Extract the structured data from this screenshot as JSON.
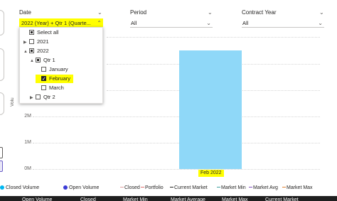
{
  "slicers": {
    "date": {
      "title": "Date",
      "value": "2022 (Year) + Qtr 1 (Quarte..."
    },
    "period": {
      "title": "Period",
      "value": "All"
    },
    "contract_year": {
      "title": "Contract Year",
      "value": "All"
    }
  },
  "date_tree": {
    "items": [
      {
        "label": "Select all",
        "state": "partial"
      },
      {
        "label": "2021",
        "state": "unchecked",
        "expandable": true,
        "expanded": false
      },
      {
        "label": "2022",
        "state": "partial",
        "expandable": true,
        "expanded": true
      },
      {
        "label": "Qtr 1",
        "state": "partial",
        "expandable": true,
        "expanded": true
      },
      {
        "label": "January",
        "state": "unchecked"
      },
      {
        "label": "February",
        "state": "checked",
        "highlighted": true
      },
      {
        "label": "March",
        "state": "unchecked"
      },
      {
        "label": "Qtr 2",
        "state": "unchecked",
        "expandable": true,
        "expanded": false
      }
    ]
  },
  "icons": {
    "expanded": "▲",
    "collapsed": "▶",
    "dropdown": "chevron-down-icon",
    "dropup": "chevron-up-icon"
  },
  "chart_data": {
    "type": "bar",
    "categories": [
      "Feb 2022"
    ],
    "values": [
      4.5
    ],
    "ylabel": "Volu",
    "yticks": [
      "0M",
      "1M",
      "2M"
    ],
    "ylim": [
      0,
      5
    ],
    "bar_color": "#8fd8f8",
    "highlight_color": "#ffff00"
  },
  "legend": {
    "items": [
      {
        "label": "Closed Volume",
        "kind": "dot",
        "color": "#00b7f1"
      },
      {
        "label": "Open Volume",
        "kind": "dot",
        "color": "#3b3bd6"
      },
      {
        "label": "Closed",
        "kind": "dash",
        "color": "#e0a0a0"
      },
      {
        "label": "Portfolio",
        "kind": "dash",
        "color": "#e07070"
      },
      {
        "label": "Current Market",
        "kind": "dash",
        "color": "#252423"
      },
      {
        "label": "Market Min",
        "kind": "dash",
        "color": "#40a0a0"
      },
      {
        "label": "Market Avg",
        "kind": "dash",
        "color": "#8050c0"
      },
      {
        "label": "Market Max",
        "kind": "dash",
        "color": "#e08030"
      }
    ]
  },
  "table_header": {
    "columns": [
      "Open Volume",
      "Closed",
      "Market Min",
      "Market Average",
      "Market Max",
      "Current Market"
    ]
  }
}
